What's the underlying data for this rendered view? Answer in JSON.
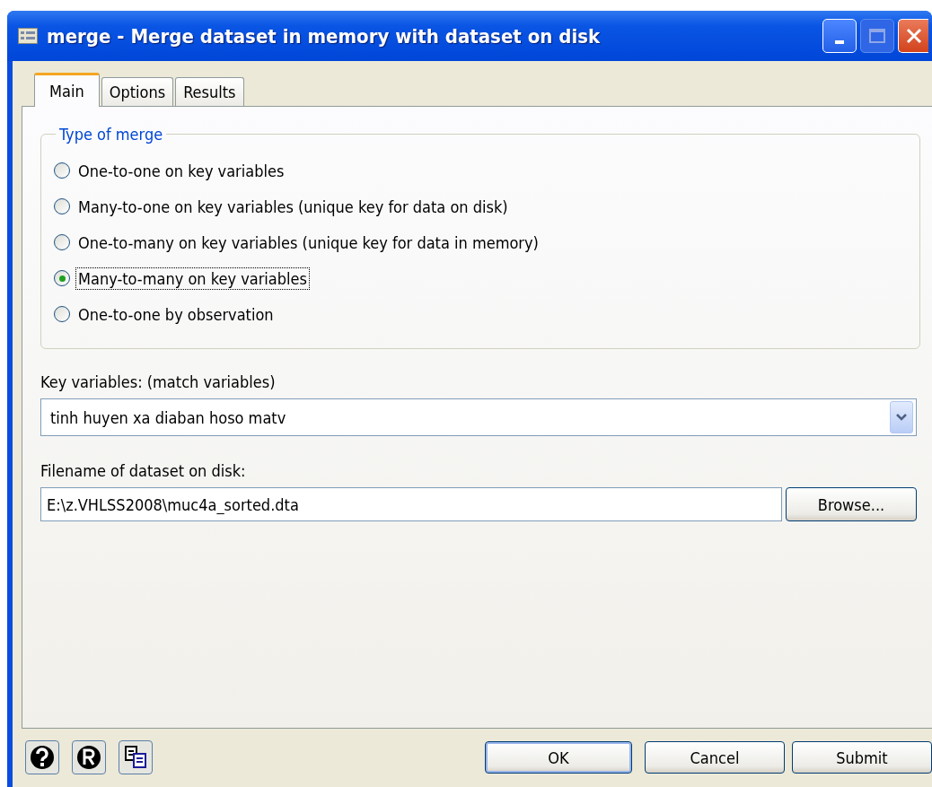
{
  "window": {
    "title": "merge - Merge dataset in memory with dataset on disk"
  },
  "tabs": [
    {
      "label": "Main",
      "selected": true
    },
    {
      "label": "Options",
      "selected": false
    },
    {
      "label": "Results",
      "selected": false
    }
  ],
  "merge_type": {
    "legend": "Type of merge",
    "options": [
      {
        "label": "One-to-one on key variables",
        "selected": false
      },
      {
        "label": "Many-to-one on key variables (unique key for data on disk)",
        "selected": false
      },
      {
        "label": "One-to-many on key variables (unique key for data in memory)",
        "selected": false
      },
      {
        "label": "Many-to-many on key variables",
        "selected": true
      },
      {
        "label": "One-to-one by observation",
        "selected": false
      }
    ]
  },
  "key_variables": {
    "label": "Key variables: (match variables)",
    "value": "tinh huyen xa diaban hoso matv"
  },
  "filename": {
    "label": "Filename of dataset on disk:",
    "value": "E:\\z.VHLSS2008\\muc4a_sorted.dta",
    "browse": "Browse..."
  },
  "buttons": [
    "OK",
    "Cancel",
    "Submit"
  ]
}
